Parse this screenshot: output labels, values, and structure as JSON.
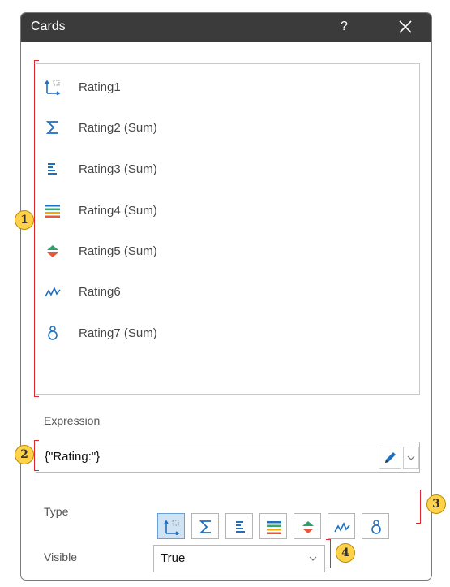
{
  "window": {
    "title": "Cards",
    "help": "?",
    "close_icon": "close-icon"
  },
  "list": {
    "items": [
      {
        "label": "Rating1",
        "icon": "card-icon"
      },
      {
        "label": "Rating2 (Sum)",
        "icon": "sum-icon"
      },
      {
        "label": "Rating3 (Sum)",
        "icon": "bars-icon"
      },
      {
        "label": "Rating4 (Sum)",
        "icon": "colored-bars-icon"
      },
      {
        "label": "Rating5 (Sum)",
        "icon": "up-down-arrows-icon"
      },
      {
        "label": "Rating6",
        "icon": "sparkline-icon"
      },
      {
        "label": "Rating7 (Sum)",
        "icon": "gauge-icon"
      }
    ]
  },
  "expression": {
    "label": "Expression",
    "value": "{\"Rating:\"}"
  },
  "type": {
    "label": "Type",
    "buttons": [
      "card-icon",
      "sum-icon",
      "bars-icon",
      "colored-bars-icon",
      "up-down-arrows-icon",
      "sparkline-icon",
      "gauge-icon"
    ],
    "selected": "card-icon"
  },
  "visible": {
    "label": "Visible",
    "value": "True"
  },
  "callouts": [
    "1",
    "2",
    "3",
    "4"
  ],
  "colors": {
    "titlebar": "#3b3b3b",
    "accent": "#1f6fbf",
    "callout_red": "#e2262c",
    "badge_yellow": "#ffd24a"
  }
}
